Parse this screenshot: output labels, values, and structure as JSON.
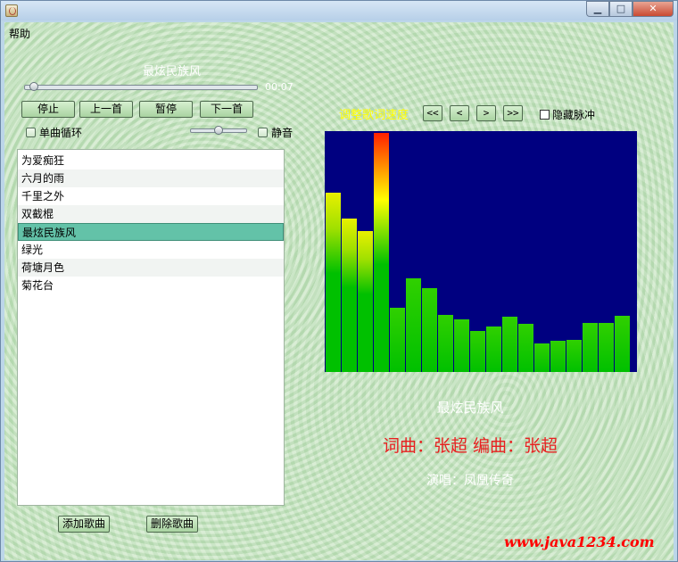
{
  "menubar": {
    "help": "帮助"
  },
  "player": {
    "current_title": "最炫民族风",
    "time": "00:07",
    "progress_fraction": 0.02,
    "volume_fraction": 0.5,
    "buttons": {
      "stop": "停止",
      "prev": "上一首",
      "pause": "暂停",
      "next": "下一首"
    },
    "single_loop": "单曲循环",
    "mute": "静音"
  },
  "playlist": {
    "items": [
      "为爱痴狂",
      "六月的雨",
      "千里之外",
      "双截棍",
      "最炫民族风",
      "绿光",
      "荷塘月色",
      "菊花台"
    ],
    "selected_index": 4,
    "add_button": "添加歌曲",
    "delete_button": "删除歌曲"
  },
  "lyrics": {
    "label": "调整歌词速度",
    "nav": [
      "<<",
      "<",
      ">",
      ">>"
    ],
    "hide_pulse": "隐藏脉冲"
  },
  "visualizer": {
    "levels": [
      0.75,
      0.64,
      0.59,
      1.0,
      0.27,
      0.39,
      0.35,
      0.24,
      0.22,
      0.17,
      0.19,
      0.23,
      0.2,
      0.12,
      0.13,
      0.135,
      0.205,
      0.205,
      0.235
    ],
    "colors": {
      "background": "#000080",
      "low": "#00c000",
      "mid": "#ffff00",
      "high": "#ff2000"
    }
  },
  "song_info": {
    "title": "最炫民族风",
    "credits": "词曲：张超 编曲：张超",
    "singer": "演唱：凤凰传奇"
  },
  "watermark": "www.java1234.com"
}
